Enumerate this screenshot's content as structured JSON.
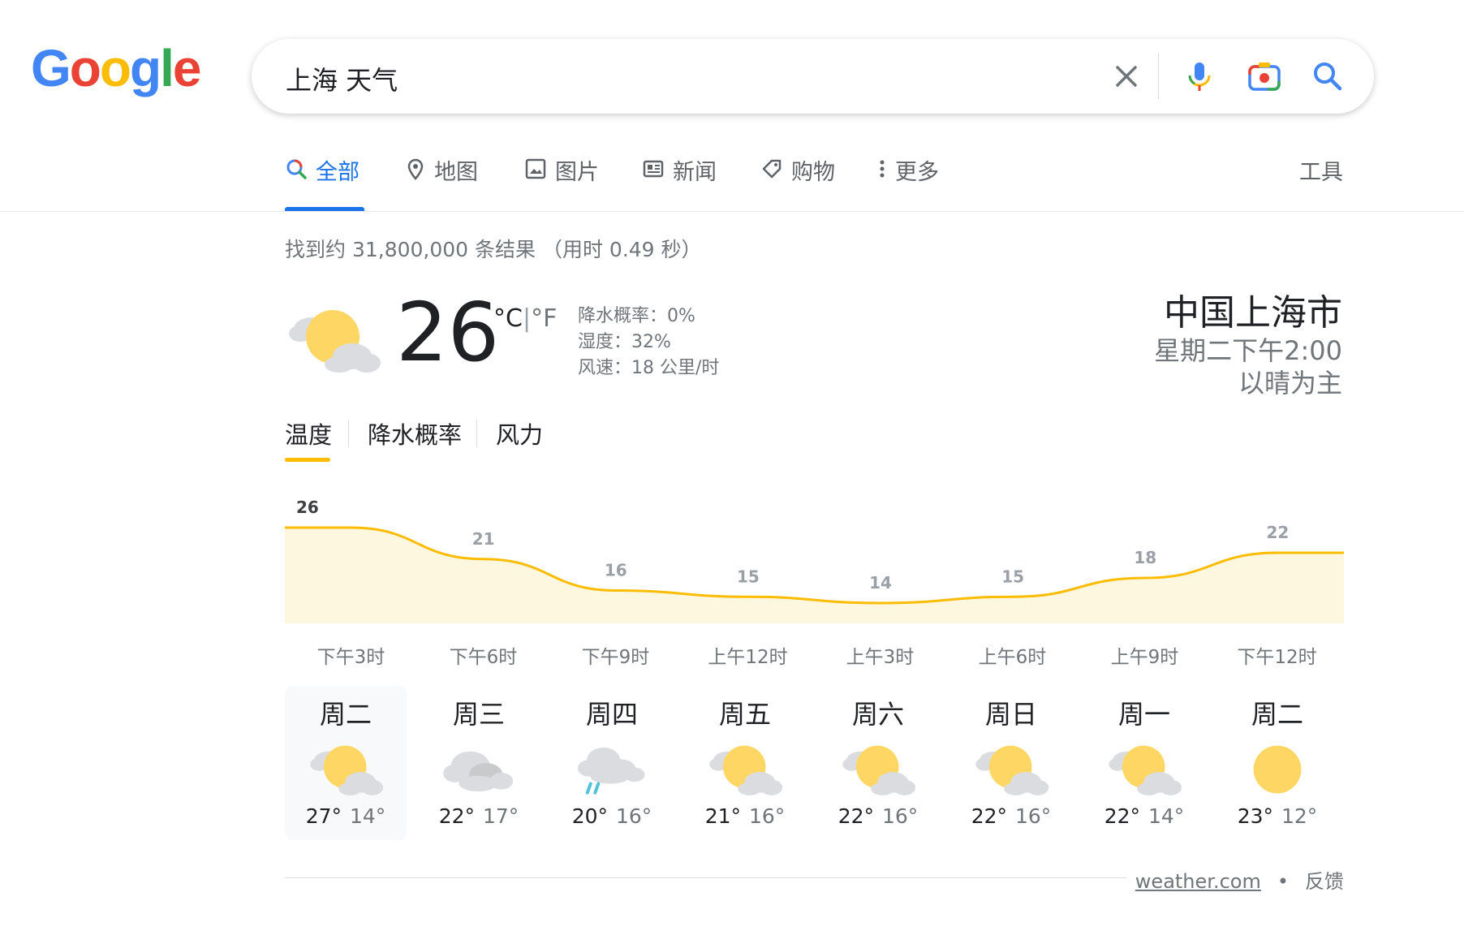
{
  "logo": {
    "letters": [
      "G",
      "o",
      "o",
      "g",
      "l",
      "e"
    ],
    "colors": [
      "#4285f4",
      "#ea4335",
      "#fbbc05",
      "#4285f4",
      "#34a853",
      "#ea4335"
    ]
  },
  "search": {
    "query": "上海 天气"
  },
  "tabs": [
    {
      "label": "全部",
      "icon": "search-icon",
      "active": true
    },
    {
      "label": "地图",
      "icon": "map-pin-icon"
    },
    {
      "label": "图片",
      "icon": "image-icon"
    },
    {
      "label": "新闻",
      "icon": "news-icon"
    },
    {
      "label": "购物",
      "icon": "tag-icon"
    },
    {
      "label": "更多",
      "icon": "more-vert-icon"
    }
  ],
  "tools_label": "工具",
  "result_stats": "找到约 31,800,000 条结果  （用时 0.49 秒）",
  "current": {
    "temp": "26",
    "unit_c": "°C",
    "unit_sep": "|",
    "unit_f": "°F",
    "precip": "降水概率：0%",
    "humidity": "湿度：32%",
    "wind": "风速：18 公里/时",
    "icon": "partly-cloudy-icon",
    "location": "中国上海市",
    "time": "星期二下午2:00",
    "description": "以晴为主"
  },
  "weather_tabs": [
    "温度",
    "降水概率",
    "风力"
  ],
  "chart_data": {
    "type": "area",
    "x": [
      "下午3时",
      "下午6时",
      "下午9时",
      "上午12时",
      "上午3时",
      "上午6时",
      "上午9时",
      "下午12时"
    ],
    "values": [
      26,
      21,
      16,
      15,
      14,
      15,
      18,
      22
    ],
    "labels": [
      "26",
      "21",
      "16",
      "15",
      "14",
      "15",
      "18",
      "22"
    ],
    "color": "#fbbc04",
    "fill": "#fef7e0"
  },
  "days": [
    {
      "name": "周二",
      "hi": "27°",
      "lo": "14°",
      "icon": "partly-cloudy-icon",
      "selected": true
    },
    {
      "name": "周三",
      "hi": "22°",
      "lo": "17°",
      "icon": "cloudy-icon"
    },
    {
      "name": "周四",
      "hi": "20°",
      "lo": "16°",
      "icon": "rain-icon"
    },
    {
      "name": "周五",
      "hi": "21°",
      "lo": "16°",
      "icon": "partly-cloudy-icon"
    },
    {
      "name": "周六",
      "hi": "22°",
      "lo": "16°",
      "icon": "partly-cloudy-icon"
    },
    {
      "name": "周日",
      "hi": "22°",
      "lo": "16°",
      "icon": "partly-cloudy-icon"
    },
    {
      "name": "周一",
      "hi": "22°",
      "lo": "14°",
      "icon": "partly-cloudy-icon"
    },
    {
      "name": "周二",
      "hi": "23°",
      "lo": "12°",
      "icon": "sunny-icon"
    }
  ],
  "footer": {
    "source": "weather.com",
    "dot": "•",
    "feedback": "反馈"
  }
}
